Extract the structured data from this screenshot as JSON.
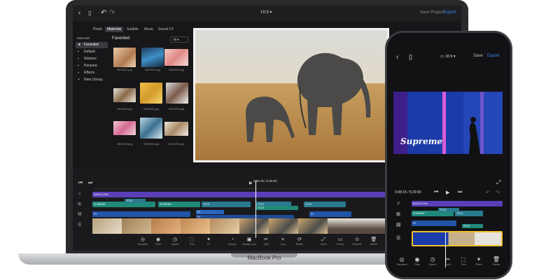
{
  "desktop": {
    "ratio": "16:9",
    "save_project": "Save Project",
    "export": "Export",
    "tabs": [
      "Photo",
      "Materials",
      "Subtitle",
      "Music",
      "Sound FX"
    ],
    "sidebar_title": "Materials",
    "sidebar_items": [
      "Favorited",
      "Default",
      "Stickers",
      "Persona",
      "Effects",
      "New Library"
    ],
    "favorited_title": "Favorited",
    "filter_value": "All",
    "thumb_labels": [
      "IMG0293.png",
      "IMG0293.png",
      "IMG0293.png",
      "IMG0293.png",
      "IMG0293.png",
      "IMG0293.png",
      "IMG0293.png",
      "IMG0293.png",
      "IMG0293.png"
    ],
    "time": "0:08:15 / 5:29:00",
    "clips": {
      "music": "BARCELONA",
      "title1": "TITLE",
      "supreme1": "SUPREME",
      "title2": "TITLE",
      "title3": "TITLE",
      "supreme2": "SUPREME",
      "title4": "TITLE",
      "title5": "TITLE",
      "fx1": "FX",
      "fx2": "FX",
      "fx3": "FX",
      "fx4": "FX"
    },
    "tools": [
      "Template",
      "Filter",
      "Speed",
      "Trim",
      "FX",
      "Volume",
      "Background",
      "Split",
      "Crop",
      "Rotate",
      "Zoom",
      "Freeze",
      "Reverse",
      "Delete"
    ]
  },
  "laptop_brand": "MacBook Pro",
  "phone": {
    "ratio": "16:9",
    "save": "Save",
    "export": "Export",
    "preview_text": "Supreme",
    "time": "0:08:15 / 5:29:00",
    "clips": {
      "barcelona": "BARCELONA",
      "title1": "TITLE",
      "supreme": "SUPREME",
      "title2": "TITLE",
      "title3": "TITLE",
      "fx": "FX"
    },
    "tools": [
      "Template",
      "Filter",
      "Speed",
      "Split",
      "Trim",
      "Effect",
      "Delete"
    ]
  },
  "colors": {
    "accent": "#2f8df7",
    "music_clip": "#5b3fb8",
    "title_clip": "#1f8a7a",
    "fx_clip": "#2255a8",
    "highlight": "#f0c030"
  }
}
